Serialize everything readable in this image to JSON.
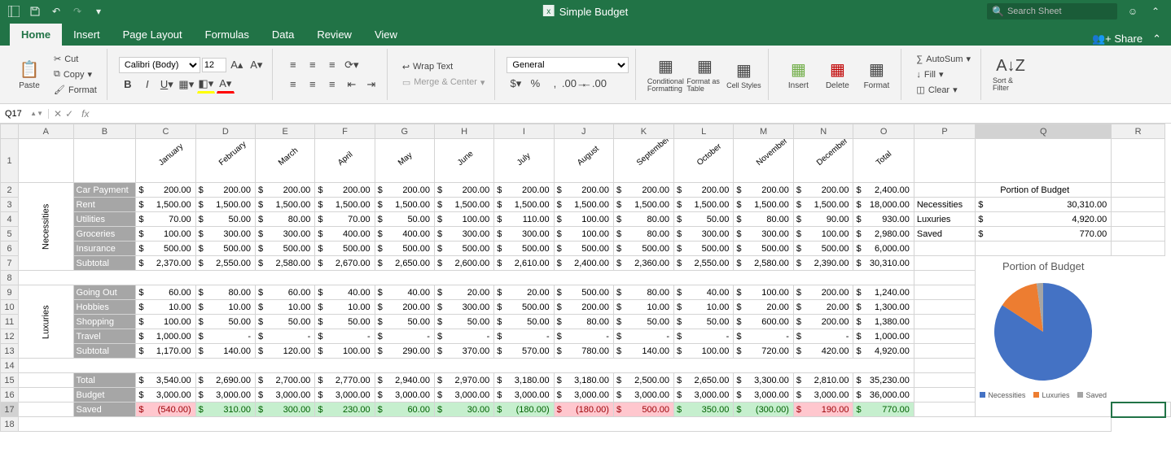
{
  "app": {
    "title": "Simple Budget",
    "search_placeholder": "Search Sheet"
  },
  "titlebar_icons": [
    "layout",
    "save",
    "undo",
    "redo",
    "more"
  ],
  "tabs": [
    "Home",
    "Insert",
    "Page Layout",
    "Formulas",
    "Data",
    "Review",
    "View"
  ],
  "active_tab": "Home",
  "share_label": "Share",
  "ribbon": {
    "paste": "Paste",
    "cut": "Cut",
    "copy": "Copy",
    "format_painter": "Format",
    "font_name": "Calibri (Body)",
    "font_size": "12",
    "wrap_label": "Wrap Text",
    "merge_label": "Merge & Center",
    "number_format": "General",
    "cond_fmt": "Conditional Formatting",
    "fmt_table": "Format as Table",
    "cell_styles": "Cell Styles",
    "insert": "Insert",
    "delete": "Delete",
    "format": "Format",
    "autosum": "AutoSum",
    "fill": "Fill",
    "clear": "Clear",
    "sort_filter": "Sort & Filter"
  },
  "namebox": "Q17",
  "columns": [
    "A",
    "B",
    "C",
    "D",
    "E",
    "F",
    "G",
    "H",
    "I",
    "J",
    "K",
    "L",
    "M",
    "N",
    "O",
    "P",
    "Q",
    "R"
  ],
  "rows": [
    1,
    2,
    3,
    4,
    5,
    6,
    7,
    8,
    9,
    10,
    11,
    12,
    13,
    14,
    15,
    16,
    17,
    18
  ],
  "months": [
    "January",
    "February",
    "March",
    "April",
    "May",
    "June",
    "July",
    "August",
    "September",
    "October",
    "November",
    "December",
    "Total"
  ],
  "section1_label": "Necessities",
  "section2_label": "Luxuries",
  "necessities": [
    {
      "label": "Car Payment",
      "vals": [
        "200.00",
        "200.00",
        "200.00",
        "200.00",
        "200.00",
        "200.00",
        "200.00",
        "200.00",
        "200.00",
        "200.00",
        "200.00",
        "200.00",
        "2,400.00"
      ]
    },
    {
      "label": "Rent",
      "vals": [
        "1,500.00",
        "1,500.00",
        "1,500.00",
        "1,500.00",
        "1,500.00",
        "1,500.00",
        "1,500.00",
        "1,500.00",
        "1,500.00",
        "1,500.00",
        "1,500.00",
        "1,500.00",
        "18,000.00"
      ]
    },
    {
      "label": "Utilities",
      "vals": [
        "70.00",
        "50.00",
        "80.00",
        "70.00",
        "50.00",
        "100.00",
        "110.00",
        "100.00",
        "80.00",
        "50.00",
        "80.00",
        "90.00",
        "930.00"
      ]
    },
    {
      "label": "Groceries",
      "vals": [
        "100.00",
        "300.00",
        "300.00",
        "400.00",
        "400.00",
        "300.00",
        "300.00",
        "100.00",
        "80.00",
        "300.00",
        "300.00",
        "100.00",
        "2,980.00"
      ]
    },
    {
      "label": "Insurance",
      "vals": [
        "500.00",
        "500.00",
        "500.00",
        "500.00",
        "500.00",
        "500.00",
        "500.00",
        "500.00",
        "500.00",
        "500.00",
        "500.00",
        "500.00",
        "6,000.00"
      ]
    }
  ],
  "necessities_subtotal": {
    "label": "Subtotal",
    "vals": [
      "2,370.00",
      "2,550.00",
      "2,580.00",
      "2,670.00",
      "2,650.00",
      "2,600.00",
      "2,610.00",
      "2,400.00",
      "2,360.00",
      "2,550.00",
      "2,580.00",
      "2,390.00",
      "30,310.00"
    ]
  },
  "luxuries": [
    {
      "label": "Going Out",
      "vals": [
        "60.00",
        "80.00",
        "60.00",
        "40.00",
        "40.00",
        "20.00",
        "20.00",
        "500.00",
        "80.00",
        "40.00",
        "100.00",
        "200.00",
        "1,240.00"
      ]
    },
    {
      "label": "Hobbies",
      "vals": [
        "10.00",
        "10.00",
        "10.00",
        "10.00",
        "200.00",
        "300.00",
        "500.00",
        "200.00",
        "10.00",
        "10.00",
        "20.00",
        "20.00",
        "1,300.00"
      ]
    },
    {
      "label": "Shopping",
      "vals": [
        "100.00",
        "50.00",
        "50.00",
        "50.00",
        "50.00",
        "50.00",
        "50.00",
        "80.00",
        "50.00",
        "50.00",
        "600.00",
        "200.00",
        "1,380.00"
      ]
    },
    {
      "label": "Travel",
      "vals": [
        "1,000.00",
        "-",
        "-",
        "-",
        "-",
        "-",
        "-",
        "-",
        "-",
        "-",
        "-",
        "-",
        "1,000.00"
      ]
    }
  ],
  "luxuries_subtotal": {
    "label": "Subtotal",
    "vals": [
      "1,170.00",
      "140.00",
      "120.00",
      "100.00",
      "290.00",
      "370.00",
      "570.00",
      "780.00",
      "140.00",
      "100.00",
      "720.00",
      "420.00",
      "4,920.00"
    ]
  },
  "totals": [
    {
      "label": "Total",
      "vals": [
        "3,540.00",
        "2,690.00",
        "2,700.00",
        "2,770.00",
        "2,940.00",
        "2,970.00",
        "3,180.00",
        "3,180.00",
        "2,500.00",
        "2,650.00",
        "3,300.00",
        "2,810.00",
        "35,230.00"
      ]
    },
    {
      "label": "Budget",
      "vals": [
        "3,000.00",
        "3,000.00",
        "3,000.00",
        "3,000.00",
        "3,000.00",
        "3,000.00",
        "3,000.00",
        "3,000.00",
        "3,000.00",
        "3,000.00",
        "3,000.00",
        "3,000.00",
        "36,000.00"
      ]
    }
  ],
  "saved": {
    "label": "Saved",
    "vals": [
      "(540.00)",
      "310.00",
      "300.00",
      "230.00",
      "60.00",
      "30.00",
      "(180.00)",
      "(180.00)",
      "500.00",
      "350.00",
      "(300.00)",
      "190.00",
      "770.00"
    ],
    "neg": [
      true,
      false,
      false,
      false,
      false,
      false,
      false,
      true,
      true,
      false,
      false,
      true,
      false,
      false
    ]
  },
  "side": {
    "title": "Portion of Budget",
    "rows": [
      {
        "label": "Necessities",
        "val": "30,310.00"
      },
      {
        "label": "Luxuries",
        "val": "4,920.00"
      },
      {
        "label": "Saved",
        "val": "770.00"
      }
    ]
  },
  "chart_data": {
    "type": "pie",
    "title": "Portion of Budget",
    "categories": [
      "Necessities",
      "Luxuries",
      "Saved"
    ],
    "values": [
      30310.0,
      4920.0,
      770.0
    ],
    "colors": [
      "#4472c4",
      "#ed7d31",
      "#a5a5a5"
    ]
  }
}
